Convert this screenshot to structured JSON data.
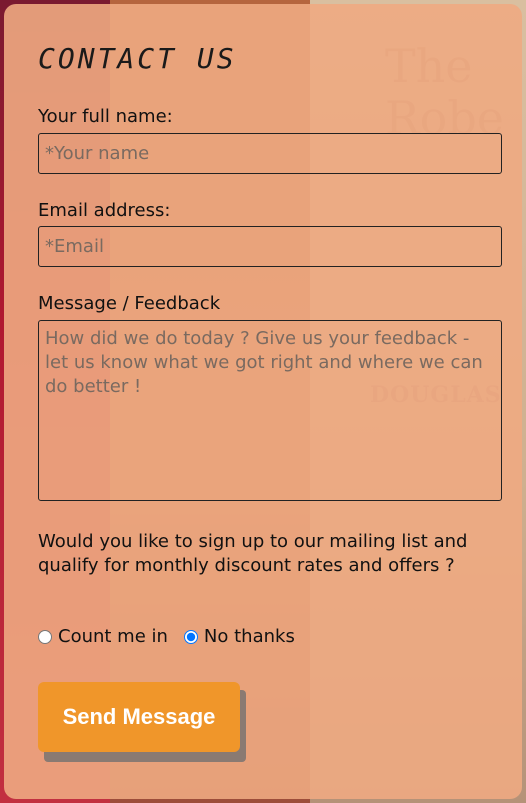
{
  "background": {
    "book_text_1": "The\nRobe",
    "book_text_2": "DOUGLAS"
  },
  "form": {
    "title": "CONTACT US",
    "name_label": "Your full name:",
    "name_placeholder": "*Your name",
    "email_label": "Email address:",
    "email_placeholder": "*Email",
    "message_label": "Message / Feedback",
    "message_placeholder": "How did we do today ? Give us your feedback - let us know what we got right and where we can do better !",
    "mailing_question": "Would you like to sign up to our mailing list and qualify for monthly discount rates and offers ?",
    "option_yes": "Count me in",
    "option_no": "No thanks",
    "selected_option": "No thanks",
    "submit_label": "Send Message"
  },
  "colors": {
    "card": "#eeaa82",
    "button": "#f0962a",
    "button_text": "#ffffff"
  }
}
